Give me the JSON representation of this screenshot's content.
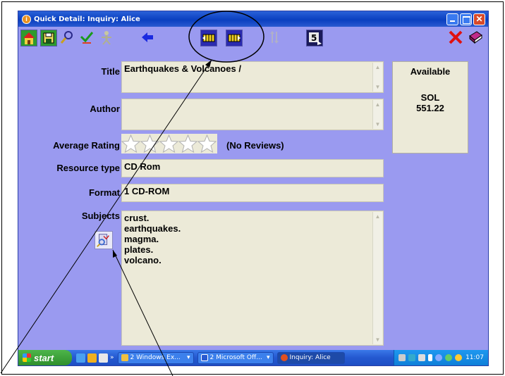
{
  "window": {
    "title": "Quick Detail: Inquiry: Alice",
    "close_glyph": "✕"
  },
  "toolbar": {
    "icons": [
      "home-icon",
      "save-icon",
      "search-icon",
      "check-icon",
      "person-icon",
      "back-arrow-icon",
      "previous-record-icon",
      "next-record-icon",
      "sort-icon",
      "export-icon",
      "delete-icon",
      "book-icon"
    ]
  },
  "record": {
    "title_label": "Title",
    "title_value": "Earthquakes & Volcanoes /",
    "author_label": "Author",
    "author_value": "",
    "rating_label": "Average Rating",
    "rating_stars_filled": 0,
    "rating_stars_total": 5,
    "reviews_text": "(No Reviews)",
    "resource_type_label": "Resource type",
    "resource_type_value": "CD Rom",
    "format_label": "Format",
    "format_value": "1 CD-ROM",
    "subjects_label": "Subjects",
    "subjects": [
      "crust.",
      "earthquakes.",
      "magma.",
      "plates.",
      "volcano."
    ]
  },
  "availability": {
    "status": "Available",
    "location": "SOL",
    "call_number": "551.22"
  },
  "taskbar": {
    "start_label": "start",
    "quicklaunch_more": "»",
    "tasks": [
      {
        "label": "2 Windows Ex...",
        "arrow": "▾"
      },
      {
        "label": "2 Microsoft Off...",
        "arrow": "▾"
      },
      {
        "label": "Inquiry: Alice"
      }
    ],
    "clock": "11:07"
  },
  "colors": {
    "window_bg": "#9a9af0",
    "field_bg": "#ecead8",
    "titlebar": "#0a3fc0",
    "annotation": "#000000"
  }
}
